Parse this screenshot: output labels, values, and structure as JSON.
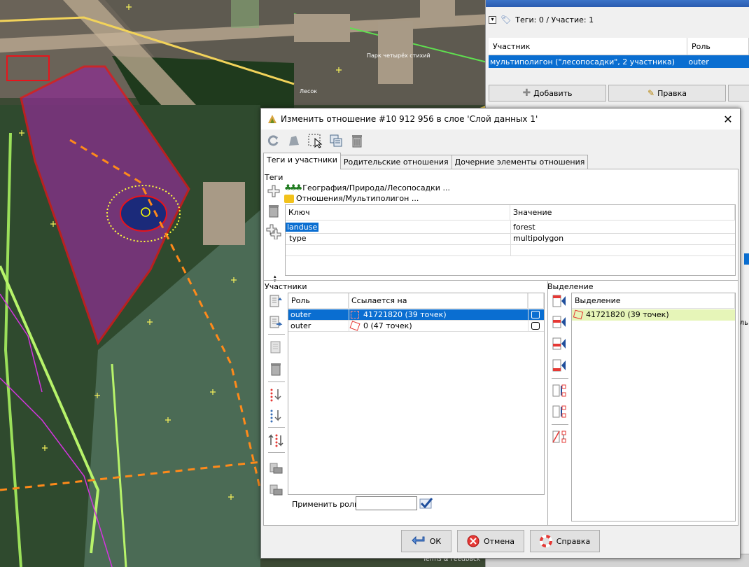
{
  "map": {
    "label_park": "Парк четырёх стихий",
    "label_forest": "Лесок",
    "label_terms": "Terms & Feedback"
  },
  "side_panel": {
    "tags_summary": "Теги: 0 / Участие: 1",
    "col_member": "Участник",
    "col_role": "Роль",
    "row_member": "мультиполигон (\"лесопосадки\", 2 участника)",
    "row_role": "outer",
    "add_label": "Добавить",
    "edit_label": "Правка",
    "right_clip_text": "ль"
  },
  "dialog": {
    "title": "Изменить отношение #10 912 956 в слое 'Слой данных 1'",
    "tabs": [
      "Теги и участники",
      "Родительские отношения",
      "Дочерние элементы отношения"
    ],
    "tags_section": "Теги",
    "preset_1": "География/Природа/Лесопосадки ...",
    "preset_2": "Отношения/Мультиполигон ...",
    "tags_table": {
      "col_key": "Ключ",
      "col_value": "Значение",
      "rows": [
        {
          "key": "landuse",
          "value": "forest"
        },
        {
          "key": "type",
          "value": "multipolygon"
        }
      ]
    },
    "members_section": "Участники",
    "members_table": {
      "col_role": "Роль",
      "col_ref": "Ссылается на",
      "rows": [
        {
          "role": "outer",
          "ref": "41721820 (39 точек)"
        },
        {
          "role": "outer",
          "ref": "0 (47 точек)"
        }
      ]
    },
    "selection_section": "Выделение",
    "selection_table": {
      "col": "Выделение",
      "rows": [
        "41721820 (39 точек)"
      ]
    },
    "apply_role_label": "Применить роль:",
    "apply_role_value": "",
    "ok_label": "ОК",
    "cancel_label": "Отмена",
    "help_label": "Справка"
  },
  "colors": {
    "selection_blue": "#0a6ed1",
    "forest_purple": "#8a2f8f",
    "outline_red": "#e8141b",
    "selection_row_green": "#e6f5b8"
  }
}
